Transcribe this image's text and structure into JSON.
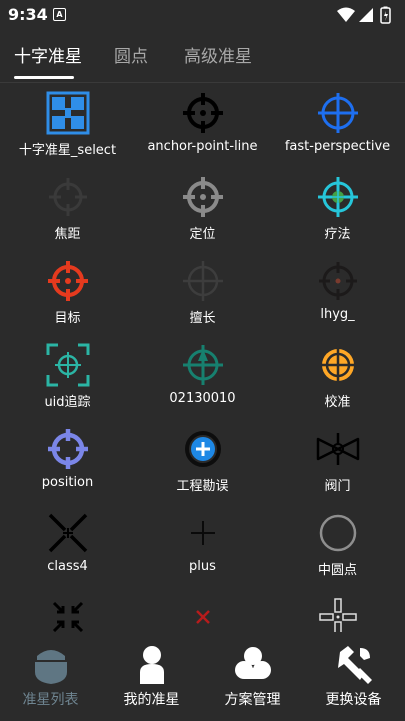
{
  "status": {
    "time": "9:34",
    "notif": "A"
  },
  "tabs": [
    {
      "label": "十字准星"
    },
    {
      "label": "圆点"
    },
    {
      "label": "高级准星"
    }
  ],
  "items": [
    {
      "label": "十字准星_select",
      "icon": "blue-square-cross-icon"
    },
    {
      "label": "anchor-point-line",
      "icon": "black-crosshair-icon"
    },
    {
      "label": "fast-perspective",
      "icon": "blue-crosshair-icon"
    },
    {
      "label": "焦距",
      "icon": "dark-crosshair-icon"
    },
    {
      "label": "定位",
      "icon": "gray-crosshair-icon"
    },
    {
      "label": "疗法",
      "icon": "cyan-green-crosshair-icon"
    },
    {
      "label": "目标",
      "icon": "red-crosshair-icon"
    },
    {
      "label": "擅长",
      "icon": "faint-crosshair-icon"
    },
    {
      "label": "lhyg_",
      "icon": "brown-crosshair-icon"
    },
    {
      "label": "uid追踪",
      "icon": "teal-bracket-crosshair-icon"
    },
    {
      "label": "02130010",
      "icon": "teal-arrow-crosshair-icon"
    },
    {
      "label": "校准",
      "icon": "orange-crosshair-icon"
    },
    {
      "label": "position",
      "icon": "purple-crosshair-icon"
    },
    {
      "label": "工程勘误",
      "icon": "blue-plus-crosshair-icon"
    },
    {
      "label": "阀门",
      "icon": "valve-icon"
    },
    {
      "label": "class4",
      "icon": "black-x-crosshair-icon"
    },
    {
      "label": "plus",
      "icon": "plus-icon"
    },
    {
      "label": "中圆点",
      "icon": "circle-icon"
    },
    {
      "label": "",
      "icon": "arrows-x-icon"
    },
    {
      "label": "",
      "icon": "red-x-icon"
    },
    {
      "label": "",
      "icon": "split-crosshair-icon"
    }
  ],
  "nav": [
    {
      "label": "准星列表",
      "icon": "crosshair-list-icon"
    },
    {
      "label": "我的准星",
      "icon": "user-icon"
    },
    {
      "label": "方案管理",
      "icon": "cloud-icon"
    },
    {
      "label": "更换设备",
      "icon": "tools-icon"
    }
  ],
  "colors": {
    "background": "#2b2b2b",
    "active_nav": "#6f8591",
    "inactive_tab": "#a8a8a8",
    "accent_blue": "#1e88e5"
  }
}
